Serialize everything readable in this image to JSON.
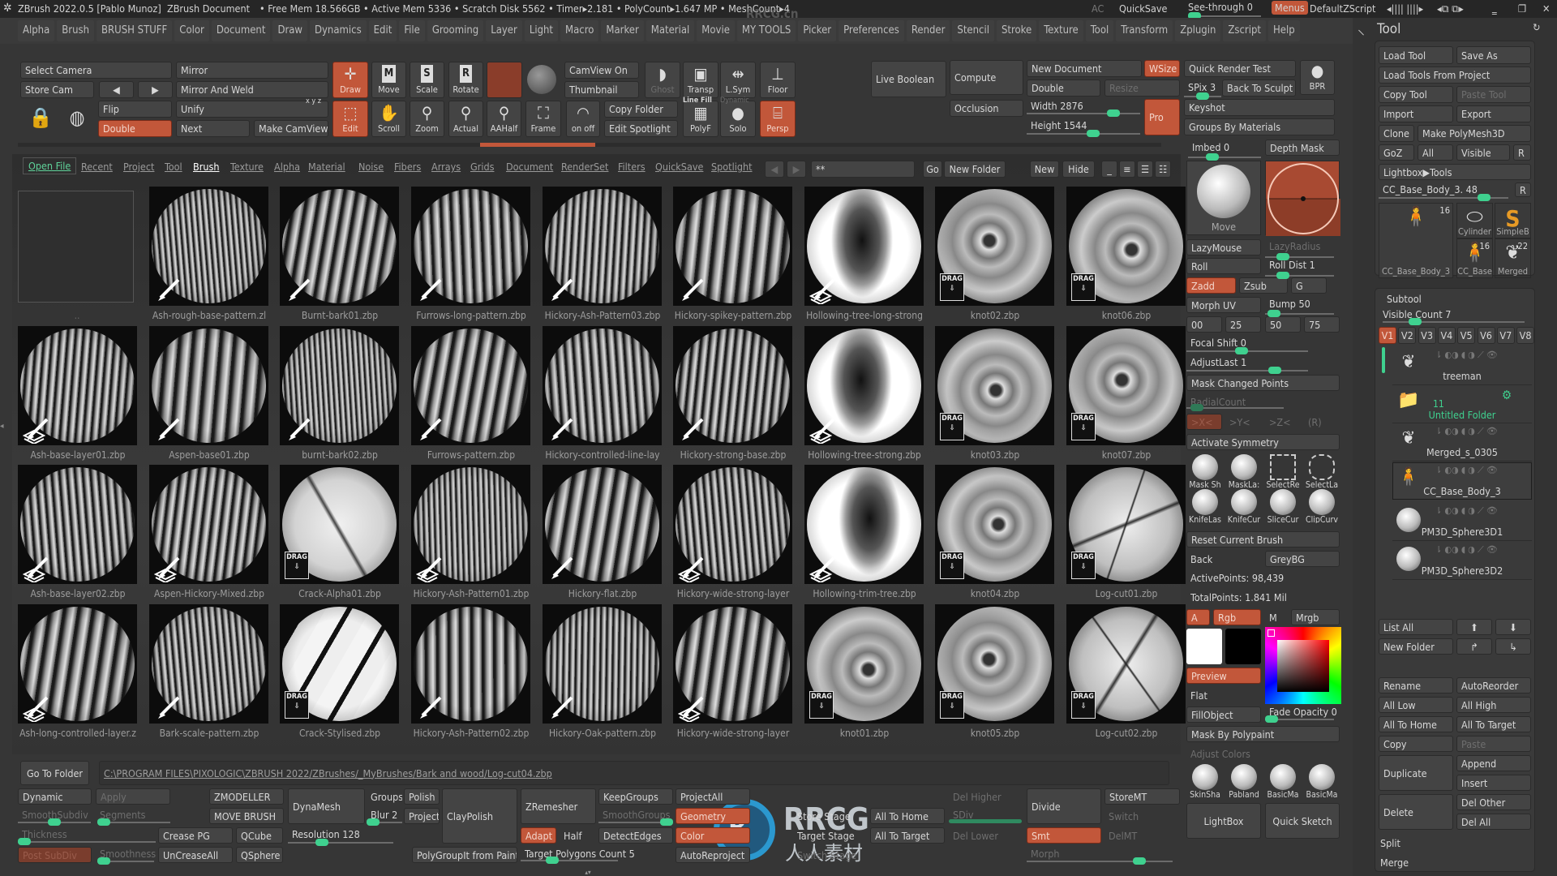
{
  "title_bar": {
    "app": "ZBrush 2022.0.5 [Pablo Munoz]",
    "document": "ZBrush Document",
    "stats": "• Free Mem 18.566GB • Active Mem 5336 • Scratch Disk 5562 •  Timer▸2.181 • PolyCount▸1.647 MP  • MeshCount▸4",
    "ac": "AC",
    "quicksave": "QuickSave",
    "see_through": "See-through  0",
    "menus": "Menus",
    "script": "DefaultZScript",
    "watermark": "RRCG.cn"
  },
  "menu": [
    "Alpha",
    "Brush",
    "BRUSH STUFF",
    "Color",
    "Document",
    "Draw",
    "Dynamics",
    "Edit",
    "File",
    "Grooming",
    "Layer",
    "Light",
    "Macro",
    "Marker",
    "Material",
    "Movie",
    "MY TOOLS",
    "Picker",
    "Preferences",
    "Render",
    "Stencil",
    "Stroke",
    "Texture",
    "Tool",
    "Transform",
    "Zplugin",
    "Zscript",
    "Help"
  ],
  "shelf": {
    "select_camera": "Select Camera",
    "store_cam": "Store Cam",
    "mirror": "Mirror",
    "mirror_and_weld": "Mirror And Weld",
    "flip": "Flip",
    "double": "Double",
    "unify": "Unify",
    "next": "Next",
    "make_camview": "Make CamView",
    "xyz": "x y z",
    "draw": "Draw",
    "edit": "Edit",
    "move": "Move",
    "scale": "Scale",
    "rotate": "Rotate",
    "move_key": "M",
    "scale_key": "S",
    "rotate_key": "R",
    "camview_on": "CamView On",
    "thumbnail": "Thumbnail",
    "ghost": "Ghost",
    "transp": "Transp",
    "lsym": "L.Sym",
    "floor": "Floor",
    "scroll": "Scroll",
    "zoom": "Zoom",
    "actual": "Actual",
    "aahalf": "AAHalf",
    "frame": "Frame",
    "on_off": "on  off",
    "copy_folder": "Copy Folder",
    "edit_spotlight": "Edit Spotlight",
    "line_fill": "Line Fill",
    "polyf": "PolyF",
    "dynamic": "Dynamic",
    "solo": "Solo",
    "persp": "Persp",
    "live_boolean": "Live Boolean",
    "compute": "Compute",
    "occlusion": "Occlusion",
    "new_document": "New Document",
    "wsize": "WSize",
    "double_doc": "Double",
    "resize": "Resize",
    "width": "Width 2876",
    "height": "Height 1544",
    "pro": "Pro",
    "quick_render_test": "Quick Render Test",
    "spix": "SPix 3",
    "back_to_sculpt": "Back To Sculpt",
    "bpr": "BPR",
    "keyshot": "Keyshot",
    "groups_by_materials": "Groups By Materials"
  },
  "browser": {
    "tabs": [
      "Open File",
      "Recent",
      "Project",
      "Tool",
      "Brush",
      "Texture",
      "Alpha",
      "Material",
      "Noise",
      "Fibers",
      "Arrays",
      "Grids",
      "Document",
      "RenderSet",
      "Filters",
      "QuickSave",
      "Spotlight"
    ],
    "active_tab": "Brush",
    "search": "**",
    "go": "Go",
    "new_folder": "New Folder",
    "new": "New",
    "hide": "Hide",
    "parent_label": "..",
    "items": [
      {
        "name": "Ash-rough-base-pattern.zl",
        "badge": "brush-icon"
      },
      {
        "name": "Burnt-bark01.zbp",
        "badge": "brush-icon"
      },
      {
        "name": "Furrows-long-pattern.zbp",
        "badge": "brush-icon"
      },
      {
        "name": "Hickory-Ash-Pattern03.zbp",
        "badge": "brush-icon"
      },
      {
        "name": "Hickory-spikey-pattern.zbp",
        "badge": "brush-icon"
      },
      {
        "name": "Hollowing-tree-long-strong",
        "badge": "brush-stack-icon"
      },
      {
        "name": "knot02.zbp",
        "badge": "drag-icon"
      },
      {
        "name": "knot06.zbp",
        "badge": "drag-icon"
      },
      {
        "name": "Ash-base-layer01.zbp",
        "badge": "brush-stack-icon"
      },
      {
        "name": "Aspen-base01.zbp",
        "badge": "brush-icon"
      },
      {
        "name": "burnt-bark02.zbp",
        "badge": "brush-icon"
      },
      {
        "name": "Furrows-pattern.zbp",
        "badge": "brush-icon"
      },
      {
        "name": "Hickory-controlled-line-lay",
        "badge": "brush-icon"
      },
      {
        "name": "Hickory-strong-base.zbp",
        "badge": "brush-icon"
      },
      {
        "name": "Hollowing-tree-strong.zbp",
        "badge": "brush-stack-icon"
      },
      {
        "name": "knot03.zbp",
        "badge": "drag-icon"
      },
      {
        "name": "knot07.zbp",
        "badge": "drag-icon"
      },
      {
        "name": "Ash-base-layer02.zbp",
        "badge": "brush-stack-icon"
      },
      {
        "name": "Aspen-Hickory-Mixed.zbp",
        "badge": "brush-stack-icon"
      },
      {
        "name": "Crack-Alpha01.zbp",
        "badge": "drag-icon"
      },
      {
        "name": "Hickory-Ash-Pattern01.zbp",
        "badge": "brush-stack-icon"
      },
      {
        "name": "Hickory-flat.zbp",
        "badge": "brush-icon"
      },
      {
        "name": "Hickory-wide-strong-layer",
        "badge": "brush-stack-icon"
      },
      {
        "name": "Hollowing-trim-tree.zbp",
        "badge": "brush-stack-icon"
      },
      {
        "name": "knot04.zbp",
        "badge": "drag-icon"
      },
      {
        "name": "Log-cut01.zbp",
        "badge": "drag-icon"
      },
      {
        "name": "Ash-long-controlled-layer.z",
        "badge": "brush-stack-icon"
      },
      {
        "name": "Bark-scale-pattern.zbp",
        "badge": "brush-icon"
      },
      {
        "name": "Crack-Stylised.zbp",
        "badge": "drag-icon"
      },
      {
        "name": "Hickory-Ash-Pattern02.zbp",
        "badge": "brush-icon"
      },
      {
        "name": "Hickory-Oak-pattern.zbp",
        "badge": "brush-icon"
      },
      {
        "name": "Hickory-wide-strong-layer",
        "badge": "brush-stack-icon"
      },
      {
        "name": "knot01.zbp",
        "badge": "drag-icon"
      },
      {
        "name": "knot05.zbp",
        "badge": "drag-icon"
      },
      {
        "name": "Log-cut02.zbp",
        "badge": "drag-icon"
      }
    ],
    "drag_label": "DRAG",
    "go_to_folder": "Go To Folder",
    "path": "C:\\PROGRAM FILES\\PIXOLOGIC\\ZBRUSH 2022/ZBrushes/_MyBrushes/Bark and wood/Log-cut04.zbp"
  },
  "brush": {
    "imbed": "Imbed 0",
    "depth_mask": "Depth Mask",
    "current_brush": "Move",
    "lazymouse": "LazyMouse",
    "lazyradius": "LazyRadius",
    "roll": "Roll",
    "roll_dist": "Roll Dist 1",
    "zadd": "Zadd",
    "zsub": "Zsub",
    "g": "G",
    "morph_uv": "Morph UV",
    "bump": "Bump 50",
    "b00": "00",
    "b25": "25",
    "b50": "50",
    "b75": "75",
    "focal_shift": "Focal Shift 0",
    "adjust_last": "AdjustLast 1",
    "mask_changed_points": "Mask Changed Points",
    "radial_count": "RadialCount",
    "sym_x": ">X<",
    "sym_y": ">Y<",
    "sym_z": ">Z<",
    "sym_r": "(R)",
    "activate_symmetry": "Activate Symmetry",
    "mask_tools": [
      "Mask Sh",
      "MaskLa:",
      "SelectRe",
      "SelectLa"
    ],
    "cut_tools": [
      "KnifeLas",
      "KnifeCur",
      "SliceCur",
      "ClipCurv"
    ],
    "reset_current_brush": "Reset Current Brush",
    "back": "Back",
    "greybg": "GreyBG",
    "active_points": "ActivePoints: 98,439",
    "total_points": "TotalPoints: 1.841 Mil",
    "a": "A",
    "rgb": "Rgb",
    "m": "M",
    "mrgb": "Mrgb",
    "preview": "Preview",
    "flat": "Flat",
    "fill_object": "FillObject",
    "fade_opacity": "Fade Opacity 0",
    "mask_by_polypaint": "Mask By Polypaint",
    "adjust_colors": "Adjust Colors",
    "materials": [
      "SkinSha",
      "Pabland",
      "BasicMa",
      "BasicMa"
    ],
    "lightbox": "LightBox",
    "quick_sketch": "Quick Sketch",
    "main_color": "#ffffff",
    "secondary_color": "#000000"
  },
  "tool": {
    "title": "Tool",
    "load_tool": "Load Tool",
    "save_as": "Save As",
    "load_tools_from_project": "Load Tools From Project",
    "copy_tool": "Copy Tool",
    "paste_tool": "Paste Tool",
    "import": "Import",
    "export": "Export",
    "clone": "Clone",
    "make_polymesh3d": "Make PolyMesh3D",
    "goz": "GoZ",
    "all": "All",
    "visible": "Visible",
    "r": "R",
    "lightbox_tools": "Lightbox▶Tools",
    "current_tool": "CC_Base_Body_3. 48",
    "r2": "R",
    "thumbs": [
      {
        "label": "CC_Base_Body_3",
        "count": "16"
      },
      {
        "label": "Cylinder"
      },
      {
        "label": "SimpleB"
      },
      {
        "label": "CC_Base",
        "count": "16"
      },
      {
        "label": "Merged",
        "count": "22"
      }
    ]
  },
  "subtool": {
    "title": "Subtool",
    "visible_count": "Visible Count 7",
    "versions": [
      "V1",
      "V2",
      "V3",
      "V4",
      "V5",
      "V6",
      "V7",
      "V8"
    ],
    "items": [
      {
        "name": "treeman"
      },
      {
        "name": "Untitled Folder",
        "count": "11"
      },
      {
        "name": "Merged_s_0305"
      },
      {
        "name": "CC_Base_Body_3"
      },
      {
        "name": "PM3D_Sphere3D1"
      },
      {
        "name": "PM3D_Sphere3D2"
      }
    ],
    "list_all": "List All",
    "new_folder": "New Folder",
    "rename": "Rename",
    "autoreorder": "AutoReorder",
    "all_low": "All Low",
    "all_high": "All High",
    "all_to_home": "All To Home",
    "all_to_target": "All To Target",
    "copy": "Copy",
    "paste": "Paste",
    "duplicate": "Duplicate",
    "append": "Append",
    "insert": "Insert",
    "delete": "Delete",
    "del_other": "Del Other",
    "del_all": "Del All",
    "split": "Split",
    "merge": "Merge"
  },
  "bottom": {
    "dynamic": "Dynamic",
    "apply": "Apply",
    "smooth_subdiv": "SmoothSubdiv",
    "segments": "Segments",
    "thickness": "Thickness",
    "post_subdiv": "Post SubDiv",
    "smoothness": "Smoothness",
    "zmodeller": "ZMODELLER",
    "move_brush": "MOVE BRUSH",
    "crease_pg": "Crease PG",
    "qcube": "QCube",
    "uncreaseall": "UnCreaseAll",
    "qsphere": "QSphere",
    "dynamesh": "DynaMesh",
    "groups": "Groups",
    "blur": "Blur 2",
    "polish": "Polish",
    "project": "Project",
    "resolution": "Resolution 128",
    "claypolish": "ClayPolish",
    "polygroupit": "PolyGroupIt from Paint",
    "zremesher": "ZRemesher",
    "adapt": "Adapt",
    "half": "Half",
    "target_polygons": "Target Polygons Count 5",
    "keepgroups": "KeepGroups",
    "smoothgroups": "SmoothGroups",
    "detectedges": "DetectEdges",
    "projectall": "ProjectAll",
    "geometry": "Geometry",
    "color": "Color",
    "autoreproject": "AutoReproject",
    "store_stage": "Store Stage",
    "target_stage": "Target Stage",
    "switch_stage": "Switch Stage",
    "all_to_home": "All To Home",
    "all_to_target": "All To Target",
    "del_higher": "Del Higher",
    "sdiv": "SDiv",
    "del_lower": "Del Lower",
    "divide": "Divide",
    "smt": "Smt",
    "morph": "Morph",
    "storemt": "StoreMT",
    "switch": "Switch",
    "delmt": "DelMT"
  },
  "watermark": {
    "logo": "RRCG",
    "sub": "人人素材"
  },
  "colors": {
    "accent": "#c2573a",
    "slider": "#3fd18f",
    "background": "#363636"
  }
}
